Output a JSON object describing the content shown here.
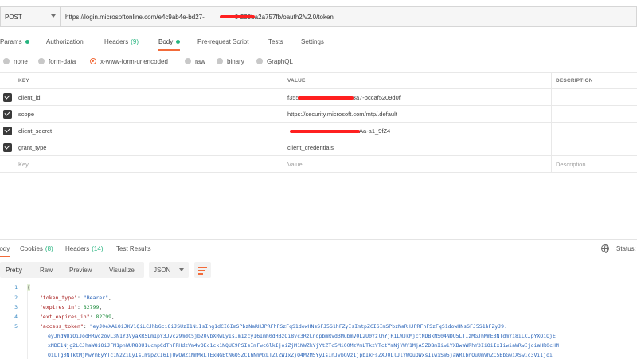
{
  "request": {
    "method": "POST",
    "url": "https://login.microsoftonline.com/e4c9ab4e-bd27-",
    "url_tail": "0-230ba2a757fb/oauth2/v2.0/token"
  },
  "request_tabs": [
    {
      "label": "Params",
      "dot": true
    },
    {
      "label": "Authorization"
    },
    {
      "label": "Headers",
      "count": "(9)"
    },
    {
      "label": "Body",
      "dot": true,
      "active": true
    },
    {
      "label": "Pre-request Script"
    },
    {
      "label": "Tests"
    },
    {
      "label": "Settings"
    }
  ],
  "body_types": [
    {
      "label": "none"
    },
    {
      "label": "form-data"
    },
    {
      "label": "x-www-form-urlencoded",
      "selected": true
    },
    {
      "label": "raw"
    },
    {
      "label": "binary"
    },
    {
      "label": "GraphQL"
    }
  ],
  "params_table": {
    "headers": {
      "key": "KEY",
      "value": "VALUE",
      "description": "DESCRIPTION"
    },
    "rows": [
      {
        "checked": true,
        "key": "client_id",
        "value_prefix": "f355",
        "value": "93a7-bccaf5209d0f"
      },
      {
        "checked": true,
        "key": "scope",
        "value": "https://security.microsoft.com/mtp/.default"
      },
      {
        "checked": true,
        "key": "client_secret",
        "value": "Aa-a1_9fZ4"
      },
      {
        "checked": true,
        "key": "grant_type",
        "value": "client_credentials"
      }
    ],
    "placeholders": {
      "key": "Key",
      "value": "Value",
      "description": "Description"
    }
  },
  "response_tabs": [
    {
      "label": "Body",
      "active": true
    },
    {
      "label": "Cookies",
      "count": "(8)"
    },
    {
      "label": "Headers",
      "count": "(14)"
    },
    {
      "label": "Test Results"
    }
  ],
  "status_label": "Status:",
  "view_modes": [
    "Pretty",
    "Raw",
    "Preview",
    "Visualize"
  ],
  "format": "JSON",
  "code": {
    "line_numbers": [
      "1",
      "2",
      "3",
      "4",
      "5"
    ],
    "open_brace": "{",
    "token_type_key": "\"token_type\"",
    "token_type_val": "\"Bearer\"",
    "expires_in_key": "\"expires_in\"",
    "expires_in_val": "82799",
    "ext_expires_in_key": "\"ext_expires_in\"",
    "ext_expires_in_val": "82799",
    "access_token_key": "\"access_token\"",
    "access_token_l1": "\"eyJ0eXAiOiJKV1QiLCJhbGciOiJSUzI1NiIsIng1dCI6ImSPbzNaRHJPRFhFSzFqS1dowHNsSFJ5S1hFZyIsImtpZCI6ImSPbzNaRHJPRFhFSzFqS1dowHNsSFJ5S1hFZyJ9.",
    "access_token_l2": "eyJhdWQiOiJodHRwczovL3N1Y3VyaXR5Lm1pY3Jvc29mdC5jb20vbXRwLyIsIm1zcyI6Imh0dHBzOi8vc3RzLndpbmRvd3MubmV0L2U0YzlhYjR1LWJkMjctNDBkNS04NDU5LTIzMGJhMmE3NTdmYi8iLCJpYXQiOjE",
    "access_token_l3": "xNDE1Njg2LCJhaW8iOiJFM1pnWUR8OU1ucmpCdThFRHdzVm4vOEc1ck1NQUE9PSIsImFwcGlkIjoiZjM1NWZkYjYtZTc5Mi00MzVmLTkzYTctYmNjYWY1MjA5ZDBmIiwiYXBwaWRhY3IiOiIxIiwiaWRwIjoiaHR0cHM",
    "access_token_l4": "OiLTg0NTktMjMwYmEyYTc1N2ZiLyIsIm9pZCI6IjUwOWZiNmMxLTExNGEtNGQ5ZC1hNmMxLTZlZWIxZjQ4M2M5YyIsInJvbGVzIjpbIkFsZXJ0LlJlYWQuQWxsIiwiSW5jaWRlbnQuUmVhZC5BbGwiXSwic3ViIjoi"
  }
}
